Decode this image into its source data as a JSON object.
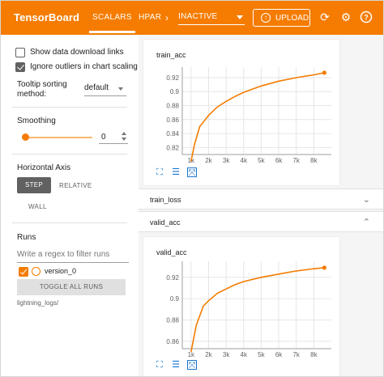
{
  "header": {
    "brand": "TensorBoard",
    "tabs": [
      {
        "label": "SCALARS",
        "active": true
      },
      {
        "label": "HPARAMS",
        "active": false
      }
    ],
    "status_dropdown": "INACTIVE",
    "upload_label": "UPLOAD",
    "icons": [
      "refresh-icon",
      "gear-icon",
      "help-icon"
    ],
    "accent_color": "#f57c00"
  },
  "sidebar": {
    "download_links": {
      "label": "Show data download links",
      "checked": false
    },
    "ignore_outliers": {
      "label": "Ignore outliers in chart scaling",
      "checked": true
    },
    "tooltip": {
      "label_line1": "Tooltip sorting",
      "label_line2": "method:",
      "value": "default"
    },
    "smoothing": {
      "label": "Smoothing",
      "value": "0",
      "level": 0
    },
    "horizontal_axis": {
      "label": "Horizontal Axis",
      "options": [
        "STEP",
        "RELATIVE",
        "WALL"
      ],
      "selected": "STEP"
    },
    "runs": {
      "label": "Runs",
      "filter_placeholder": "Write a regex to filter runs",
      "items": [
        {
          "name": "version_0",
          "checked": true,
          "color": "#f57c00"
        }
      ],
      "toggle_label": "TOGGLE ALL RUNS",
      "logdir": "lightning_logs/"
    }
  },
  "main": {
    "train_acc_title": "train_acc",
    "train_loss_label": "train_loss",
    "valid_acc_label": "valid_acc",
    "valid_acc_title": "valid_acc"
  },
  "chart_data": [
    {
      "type": "line",
      "title": "train_acc",
      "x": [
        1000,
        1200,
        1500,
        2000,
        2500,
        3000,
        3500,
        4000,
        5000,
        6000,
        7000,
        8000,
        8600
      ],
      "y": [
        0.8,
        0.825,
        0.85,
        0.866,
        0.878,
        0.886,
        0.893,
        0.899,
        0.908,
        0.915,
        0.92,
        0.924,
        0.927
      ],
      "xticks": [
        "1k",
        "2k",
        "3k",
        "4k",
        "5k",
        "6k",
        "7k",
        "8k"
      ],
      "yticks": [
        "0.82",
        "0.84",
        "0.86",
        "0.88",
        "0.9",
        "0.92"
      ],
      "xlim": [
        500,
        9000
      ],
      "ylim": [
        0.81,
        0.935
      ],
      "grid": true,
      "series_color": "#f57c00"
    },
    {
      "type": "line",
      "title": "valid_acc",
      "x": [
        1000,
        1300,
        1700,
        2000,
        2500,
        3000,
        3500,
        4000,
        5000,
        6000,
        7000,
        8000,
        8600
      ],
      "y": [
        0.85,
        0.875,
        0.893,
        0.898,
        0.905,
        0.909,
        0.913,
        0.916,
        0.92,
        0.923,
        0.926,
        0.928,
        0.929
      ],
      "xticks": [
        "1k",
        "2k",
        "3k",
        "4k",
        "5k",
        "6k",
        "7k",
        "8k"
      ],
      "yticks": [
        "0.86",
        "0.88",
        "0.9",
        "0.92"
      ],
      "xlim": [
        500,
        9000
      ],
      "ylim": [
        0.853,
        0.935
      ],
      "grid": true,
      "series_color": "#f57c00"
    }
  ]
}
